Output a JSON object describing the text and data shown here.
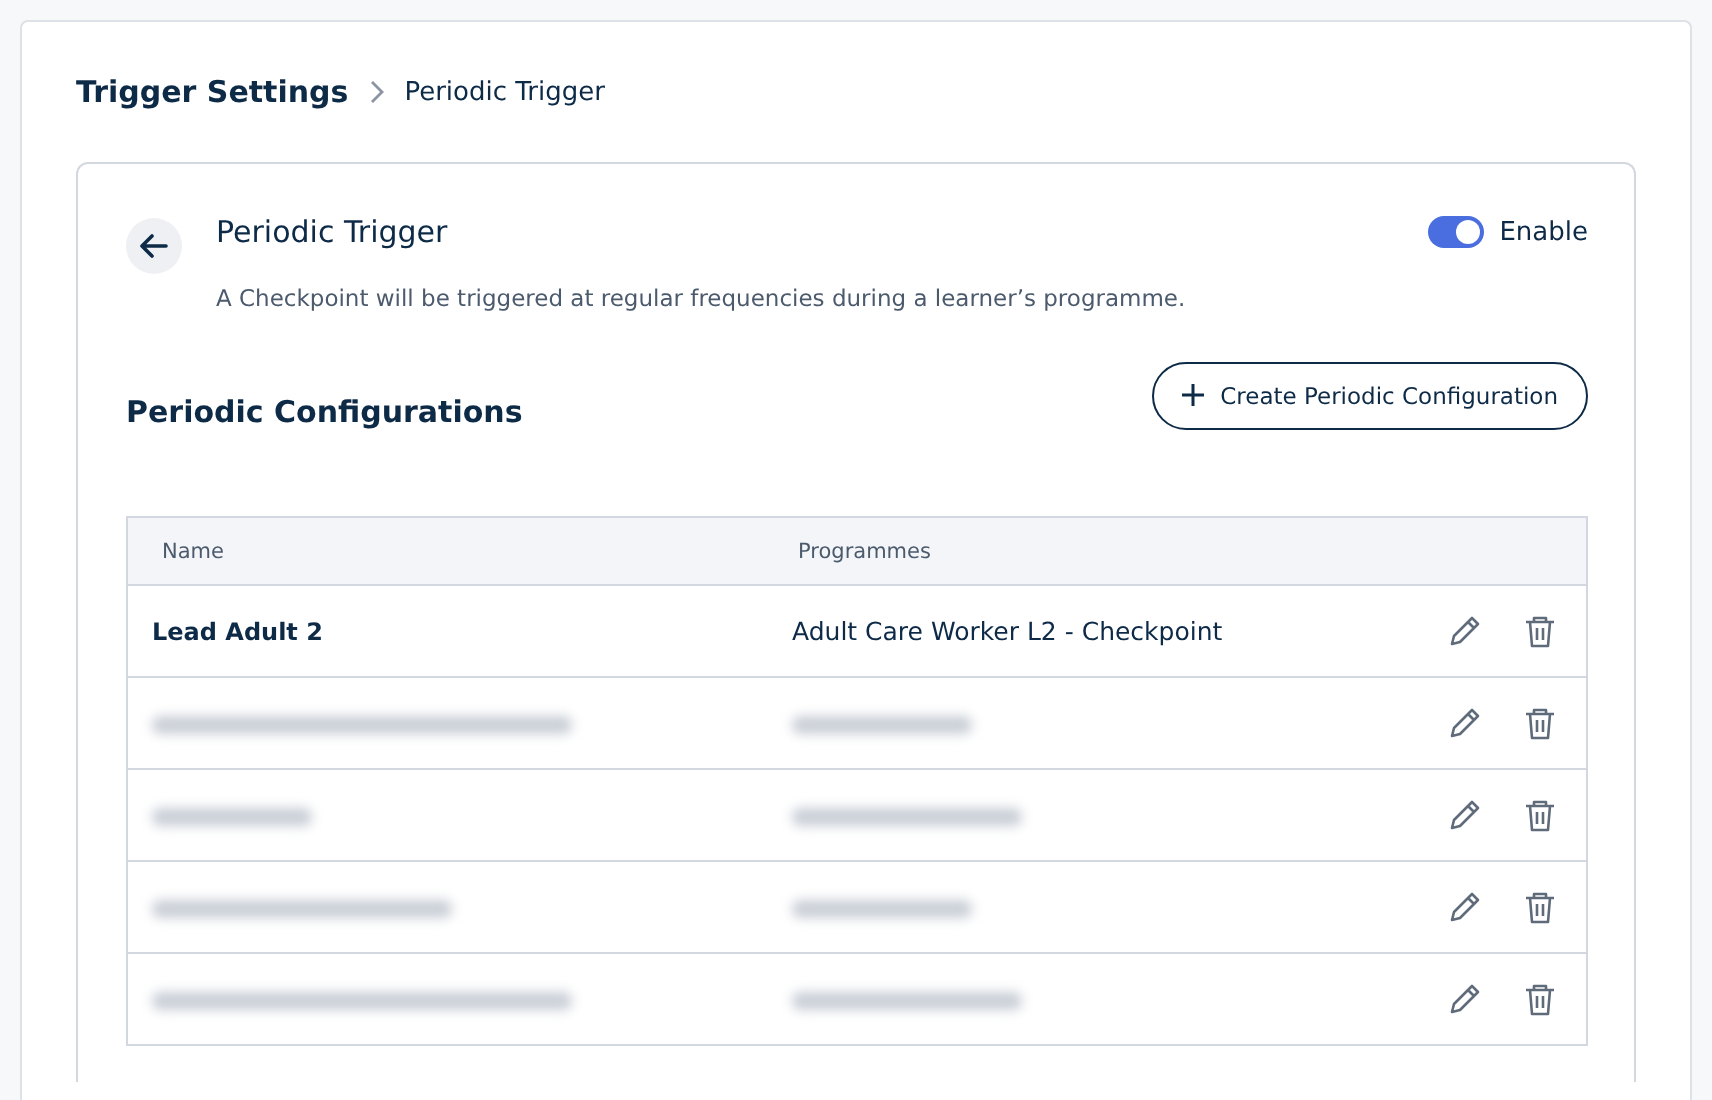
{
  "breadcrumb": [
    {
      "label": "Trigger Settings",
      "current": false
    },
    {
      "label": "Periodic Trigger",
      "current": true
    }
  ],
  "trigger": {
    "title": "Periodic Trigger",
    "description": "A Checkpoint will be triggered at regular frequencies during a learner’s programme.",
    "toggle": {
      "label": "Enable",
      "on": true
    }
  },
  "configurations": {
    "title": "Periodic Configurations",
    "create_button": "Create Periodic Configuration",
    "table": {
      "columns": [
        "Name",
        "Programmes"
      ],
      "rows": [
        {
          "redacted": false,
          "name": "Lead Adult 2",
          "programmes": "Adult Care Worker L2 - Checkpoint"
        },
        {
          "redacted": true
        },
        {
          "redacted": true
        },
        {
          "redacted": true
        },
        {
          "redacted": true
        }
      ]
    }
  }
}
